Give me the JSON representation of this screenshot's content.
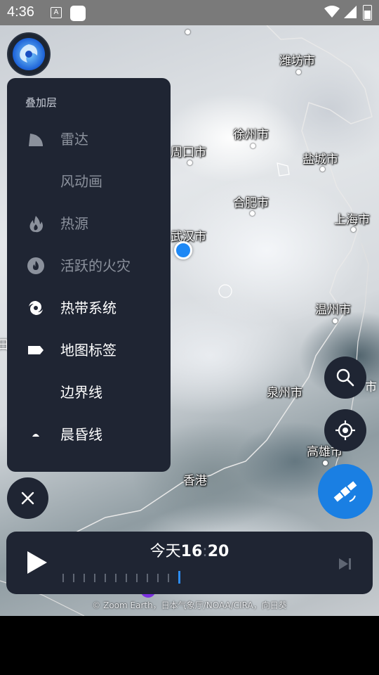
{
  "status_bar": {
    "time": "4:36",
    "notification_icon_letter": "A",
    "icons": [
      "text-notification-icon",
      "app-notification-icon",
      "wifi-icon",
      "cell-signal-icon",
      "battery-icon"
    ]
  },
  "map": {
    "cities": [
      {
        "name": "潍坊市"
      },
      {
        "name": "徐州市"
      },
      {
        "name": "周口市"
      },
      {
        "name": "盐城市"
      },
      {
        "name": "合肥市"
      },
      {
        "name": "上海市"
      },
      {
        "name": "武汉市"
      },
      {
        "name": "温州市"
      },
      {
        "name": "泉州市"
      },
      {
        "name": "高雄市"
      },
      {
        "name": "香港"
      }
    ],
    "partial_labels": [
      "日",
      "市"
    ],
    "credit": "© Zoom Earth，日本气象厅/NOAA/CIRA，向日葵"
  },
  "layers_panel": {
    "header": "叠加层",
    "items": [
      {
        "label": "雷达",
        "icon": "radar-icon",
        "enabled": false
      },
      {
        "label": "风动画",
        "icon": "",
        "enabled": false
      },
      {
        "label": "热源",
        "icon": "fire-icon",
        "enabled": false
      },
      {
        "label": "活跃的火灾",
        "icon": "active-fire-icon",
        "enabled": false
      },
      {
        "label": "热带系统",
        "icon": "hurricane-icon",
        "enabled": true
      },
      {
        "label": "地图标签",
        "icon": "label-tag-icon",
        "enabled": true
      },
      {
        "label": "边界线",
        "icon": "",
        "enabled": true
      },
      {
        "label": "晨昏线",
        "icon": "daylight-arc-icon",
        "enabled": true
      }
    ]
  },
  "player": {
    "day": "今天",
    "hour": "16",
    "minute": "20",
    "tick_count": 12,
    "current_tick": 11
  },
  "colors": {
    "panel_bg": "#1f2533",
    "accent": "#1a7fe3",
    "location_dot": "#1e88f5",
    "muted_text": "#8b919c"
  }
}
